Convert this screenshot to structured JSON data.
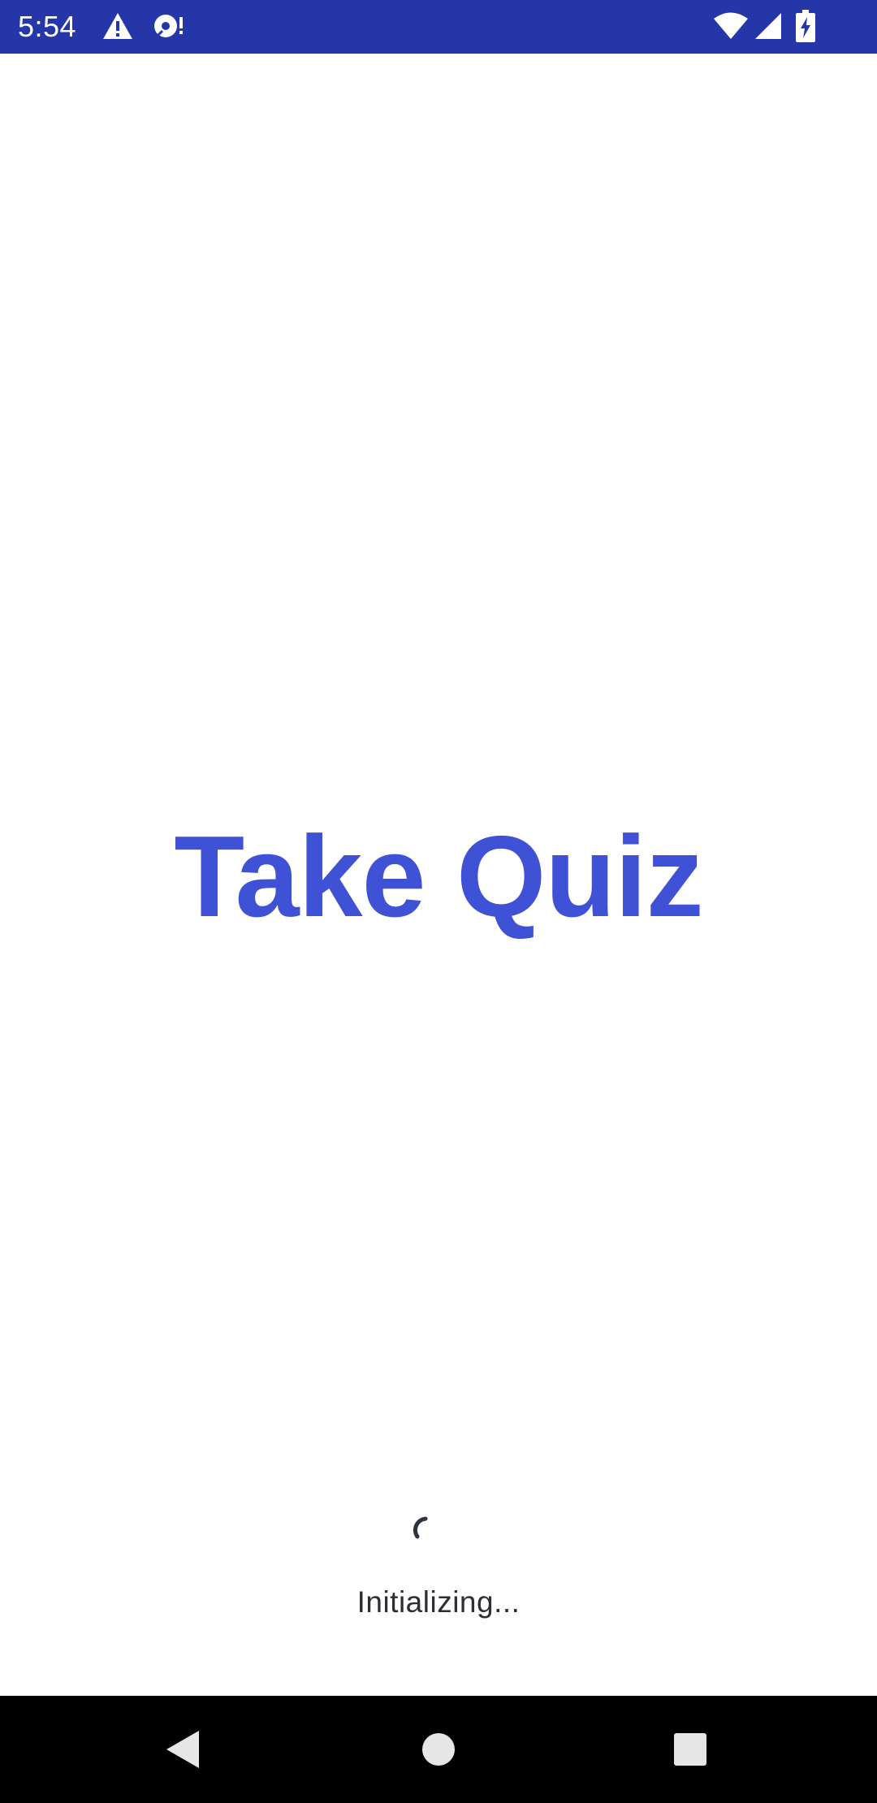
{
  "status_bar": {
    "time": "5:54",
    "background": "#2536a8",
    "left_icons": [
      "warning-icon",
      "sim-card-alert-icon"
    ],
    "right_icons": [
      "wifi-icon",
      "cell-signal-icon",
      "battery-charging-icon"
    ]
  },
  "main": {
    "title": "Take Quiz",
    "title_color": "#3f51d4",
    "loading_text": "Initializing..."
  },
  "nav_bar": {
    "buttons": [
      "back-button",
      "home-button",
      "recents-button"
    ]
  }
}
